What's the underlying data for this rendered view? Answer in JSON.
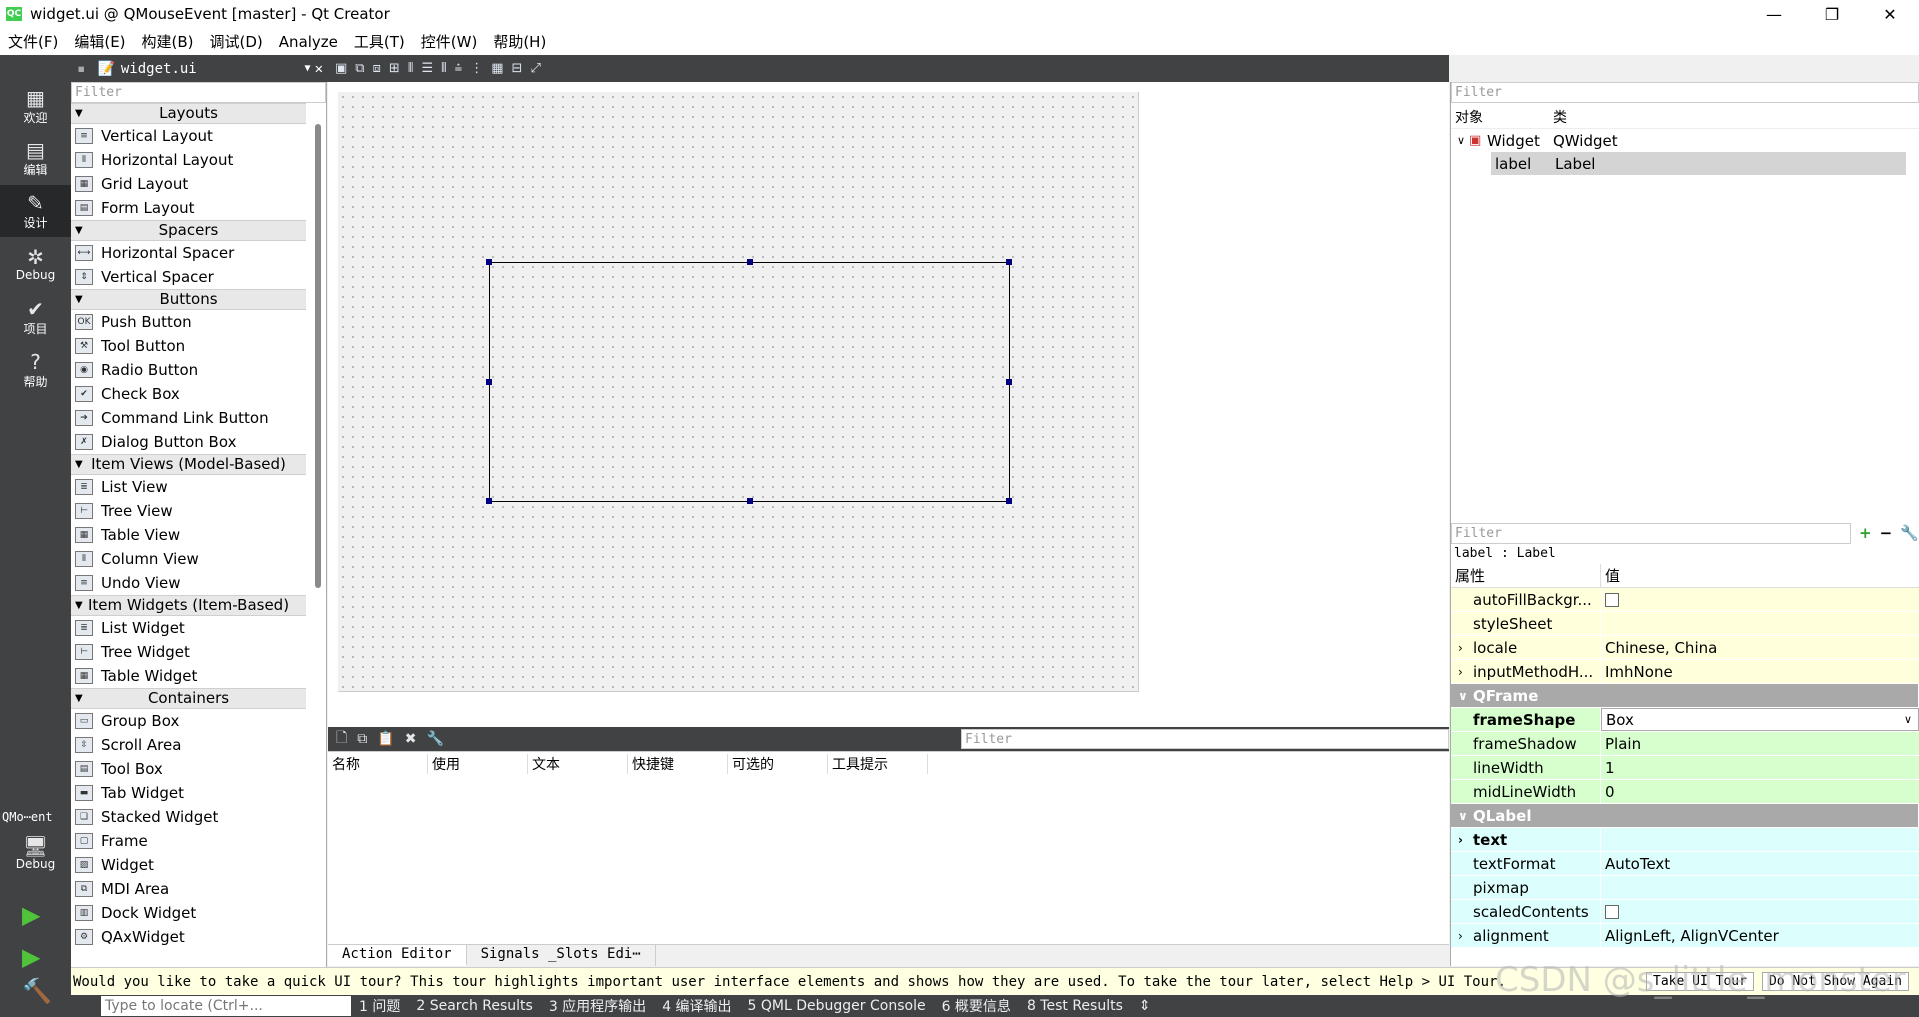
{
  "window": {
    "title": "widget.ui @ QMouseEvent [master] - Qt Creator",
    "app_icon": "QC",
    "minimize": "—",
    "maximize": "❐",
    "close": "✕"
  },
  "menu": [
    "文件(F)",
    "编辑(E)",
    "构建(B)",
    "调试(D)",
    "Analyze",
    "工具(T)",
    "控件(W)",
    "帮助(H)"
  ],
  "modes": [
    {
      "label": "欢迎",
      "icon": "▦"
    },
    {
      "label": "编辑",
      "icon": "▤"
    },
    {
      "label": "设计",
      "icon": "✎"
    },
    {
      "label": "Debug",
      "icon": "✲"
    },
    {
      "label": "项目",
      "icon": "✔"
    },
    {
      "label": "帮助",
      "icon": "?"
    }
  ],
  "target": {
    "project": "QMo⋯ent",
    "label": "Debug"
  },
  "editor": {
    "filename": "widget.ui"
  },
  "widgetbox": {
    "filter_placeholder": "Filter",
    "categories": [
      {
        "name": "Layouts",
        "items": [
          "Vertical Layout",
          "Horizontal Layout",
          "Grid Layout",
          "Form Layout"
        ]
      },
      {
        "name": "Spacers",
        "items": [
          "Horizontal Spacer",
          "Vertical Spacer"
        ]
      },
      {
        "name": "Buttons",
        "items": [
          "Push Button",
          "Tool Button",
          "Radio Button",
          "Check Box",
          "Command Link Button",
          "Dialog Button Box"
        ]
      },
      {
        "name": "Item Views (Model-Based)",
        "items": [
          "List View",
          "Tree View",
          "Table View",
          "Column View",
          "Undo View"
        ]
      },
      {
        "name": "Item Widgets (Item-Based)",
        "items": [
          "List Widget",
          "Tree Widget",
          "Table Widget"
        ]
      },
      {
        "name": "Containers",
        "items": [
          "Group Box",
          "Scroll Area",
          "Tool Box",
          "Tab Widget",
          "Stacked Widget",
          "Frame",
          "Widget",
          "MDI Area",
          "Dock Widget",
          "QAxWidget"
        ]
      }
    ]
  },
  "action_editor": {
    "filter_placeholder": "Filter",
    "columns": [
      "名称",
      "使用",
      "文本",
      "快捷键",
      "可选的",
      "工具提示"
    ],
    "tabs": [
      "Action Editor",
      "Signals _Slots Edi⋯"
    ]
  },
  "object_inspector": {
    "filter_placeholder": "Filter",
    "columns": [
      "对象",
      "类"
    ],
    "rows": [
      {
        "object": "Widget",
        "class": "QWidget"
      },
      {
        "object": "label",
        "class": "Label"
      }
    ]
  },
  "property_editor": {
    "filter_placeholder": "Filter",
    "context": "label : Label",
    "columns": [
      "属性",
      "值"
    ],
    "rows": [
      {
        "name": "autoFillBackgr...",
        "value": ""
      },
      {
        "name": "styleSheet",
        "value": ""
      },
      {
        "name": "locale",
        "value": "Chinese, China"
      },
      {
        "name": "inputMethodH...",
        "value": "ImhNone"
      },
      {
        "name": "QFrame",
        "value": ""
      },
      {
        "name": "frameShape",
        "value": "Box"
      },
      {
        "name": "frameShadow",
        "value": "Plain"
      },
      {
        "name": "lineWidth",
        "value": "1"
      },
      {
        "name": "midLineWidth",
        "value": "0"
      },
      {
        "name": "QLabel",
        "value": ""
      },
      {
        "name": "text",
        "value": ""
      },
      {
        "name": "textFormat",
        "value": "AutoText"
      },
      {
        "name": "pixmap",
        "value": ""
      },
      {
        "name": "scaledContents",
        "value": ""
      },
      {
        "name": "alignment",
        "value": "AlignLeft, AlignVCenter"
      }
    ]
  },
  "tour": {
    "message": "Would you like to take a quick UI tour? This tour highlights important user interface elements and shows how they are used. To take the tour later, select Help > UI Tour.",
    "take": "Take UI Tour",
    "dismiss": "Do Not Show Again"
  },
  "status": {
    "locate_placeholder": "Type to locate (Ctrl+...",
    "panes": [
      "1 问题",
      "2 Search Results",
      "3 应用程序输出",
      "4 编译输出",
      "5 QML Debugger Console",
      "6 概要信息",
      "8 Test Results"
    ]
  },
  "watermark": "CSDN @s_little_monster"
}
